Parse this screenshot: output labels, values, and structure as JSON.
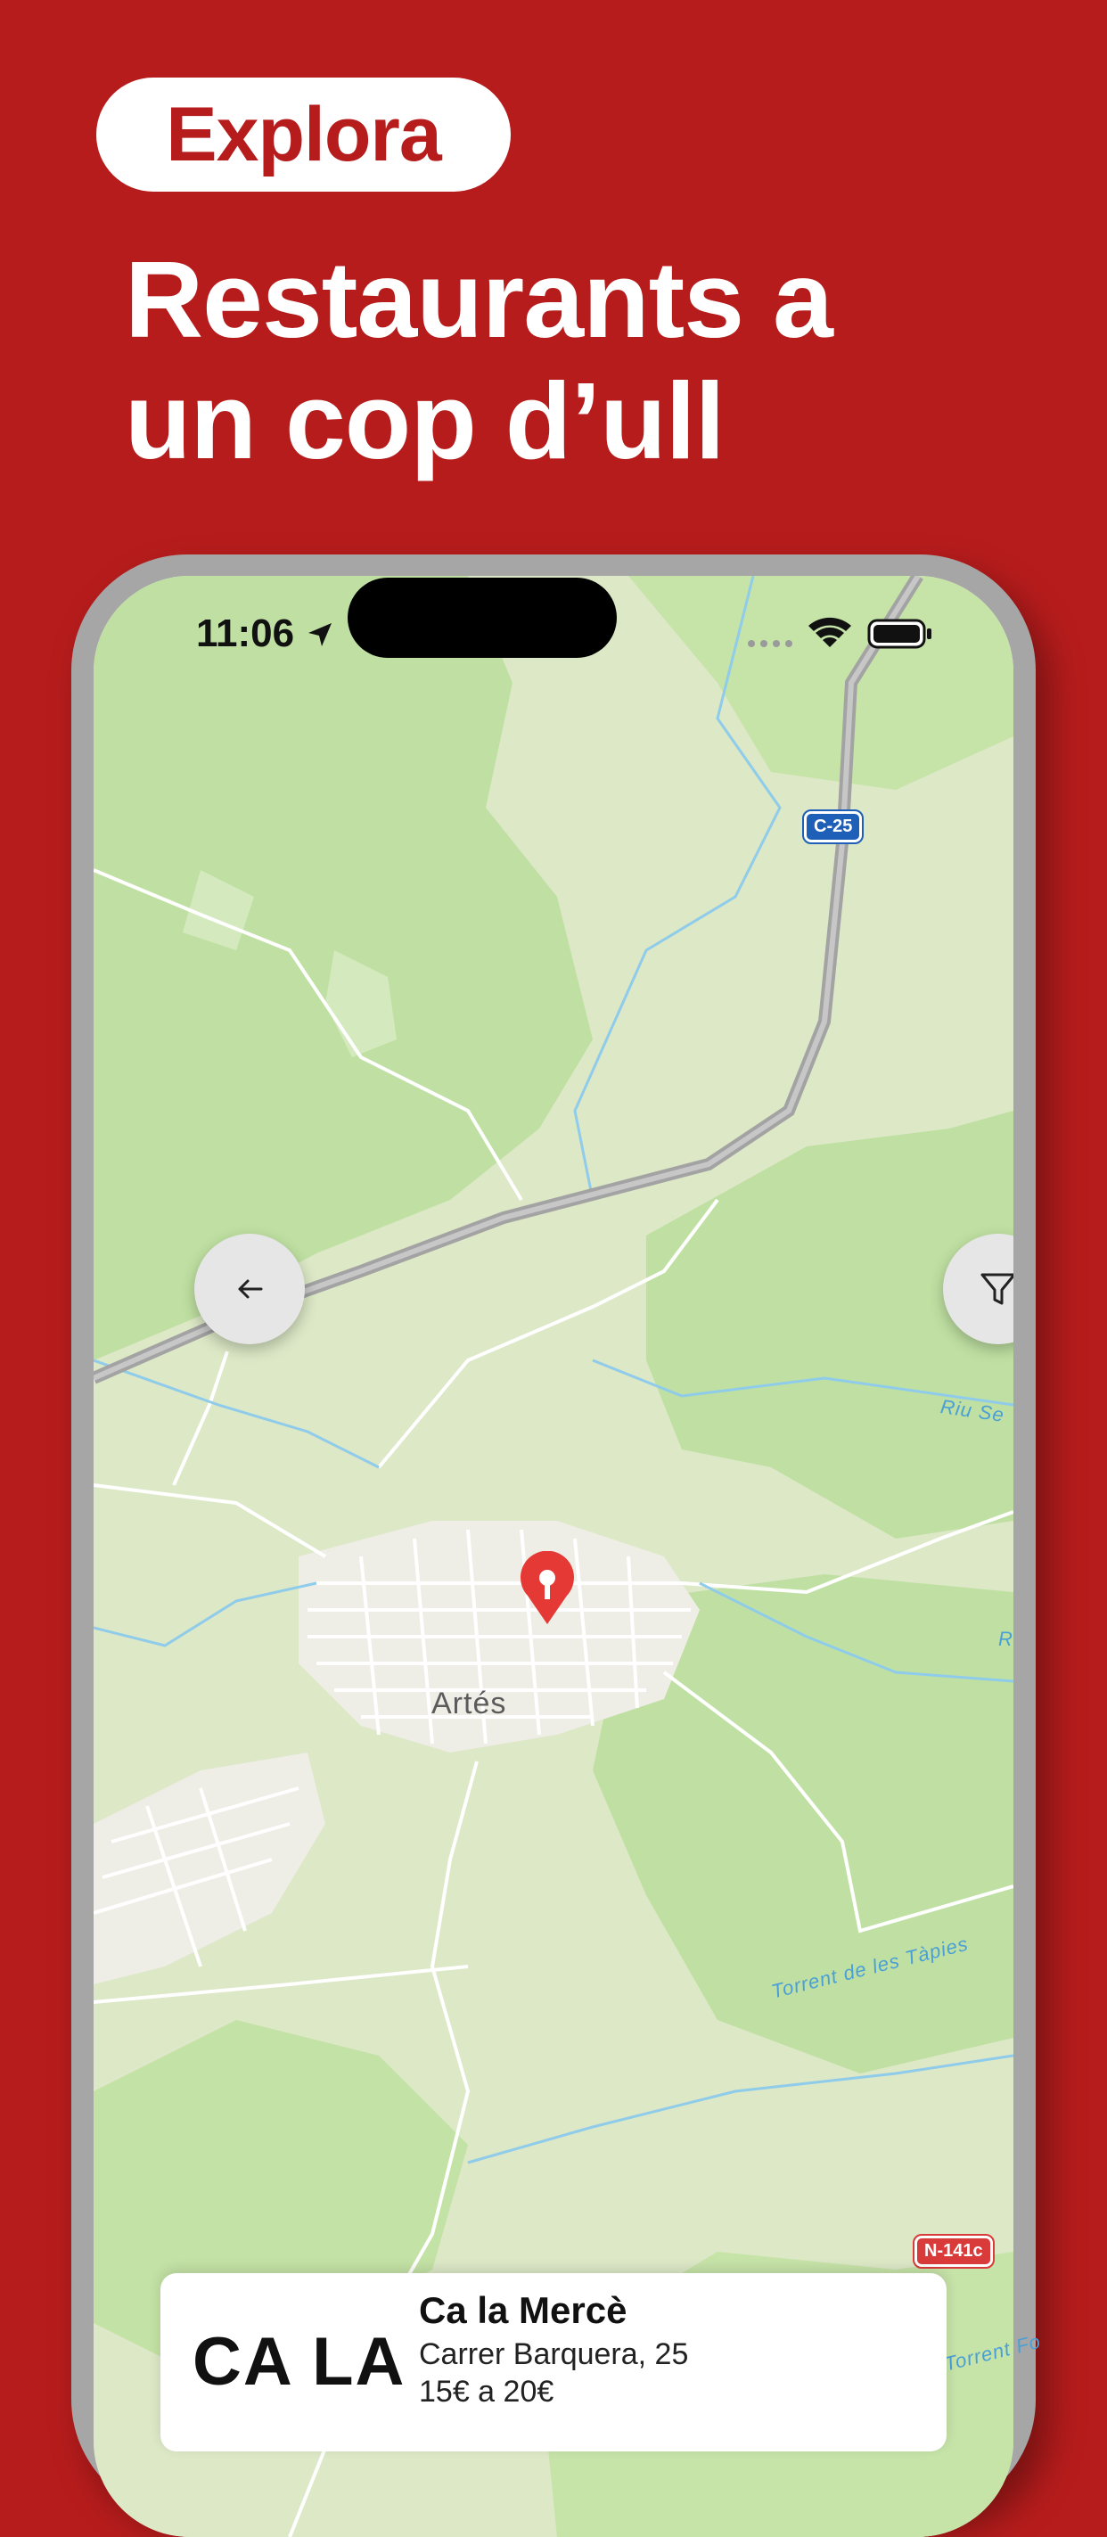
{
  "badge": {
    "label": "Explora"
  },
  "headline": {
    "line1": "Restaurants a",
    "line2": "un cop d’ull"
  },
  "status_bar": {
    "time": "11:06"
  },
  "map": {
    "town_label": "Artés",
    "road_badges": [
      "C-25",
      "N-141c"
    ],
    "river_labels": [
      "Riu Se",
      "Torrent de les Tàpies",
      "Torrent Fo",
      "R"
    ]
  },
  "icons": {
    "back": "arrow-left-icon",
    "filter": "filter-icon",
    "location": "location-arrow-icon",
    "pin": "map-pin-icon"
  },
  "card": {
    "logo_text": "CA LA",
    "name": "Ca la Mercè",
    "address": "Carrer Barquera, 25",
    "price": "15€ a 20€"
  },
  "colors": {
    "background": "#B71C1C",
    "brand": "#B71C1C",
    "pin": "#E53935",
    "road_badge": "#1E5FB8"
  }
}
